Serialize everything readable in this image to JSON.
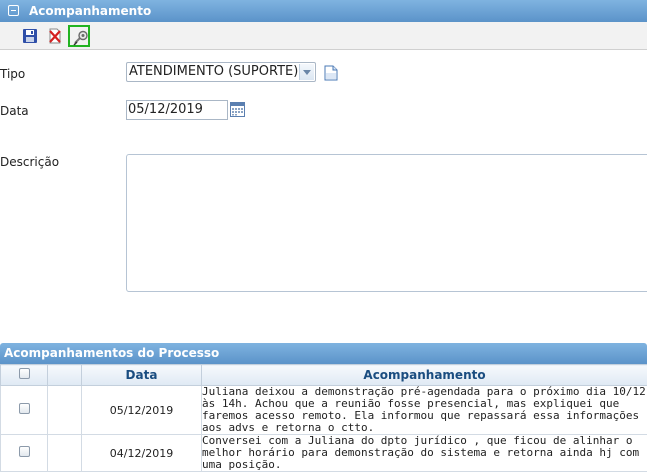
{
  "panel": {
    "title": "Acompanhamento"
  },
  "toolbar": {
    "buttons": [
      {
        "icon": "save-icon"
      },
      {
        "icon": "delete-icon"
      },
      {
        "icon": "attach-icon",
        "selected": true
      }
    ]
  },
  "form": {
    "tipo_label": "Tipo",
    "tipo_value": "ATENDIMENTO (SUPORTE)",
    "data_label": "Data",
    "data_value": "05/12/2019",
    "descricao_label": "Descrição",
    "descricao_value": ""
  },
  "grid": {
    "title": "Acompanhamentos do Processo",
    "columns": [
      "",
      "",
      "Data",
      "Acompanhamento"
    ],
    "rows": [
      {
        "date": "05/12/2019",
        "text": "Juliana deixou a demonstração pré-agendada para o próximo dia 10/12 às 14h. Achou que a reunião fosse presencial, mas expliquei que faremos acesso remoto. Ela informou que repassará essa informações aos advs e retorna o ctto."
      },
      {
        "date": "04/12/2019",
        "text": "Conversei com a Juliana do dpto jurídico , que ficou de alinhar o melhor horário para demonstração do sistema e retorna ainda hj com uma posição."
      }
    ]
  },
  "colors": {
    "header_blue": "#5b93c9",
    "highlight_green": "#22b322",
    "grid_header_text": "#1a4d80"
  }
}
